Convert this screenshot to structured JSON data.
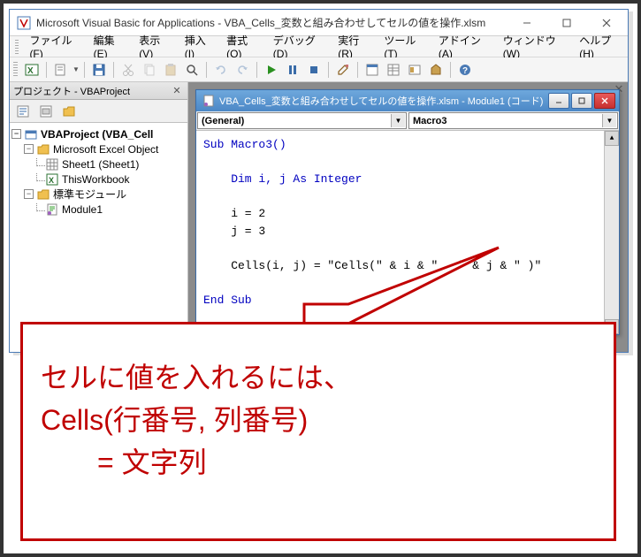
{
  "window": {
    "title": "Microsoft Visual Basic for Applications - VBA_Cells_変数と組み合わせしてセルの値を操作.xlsm"
  },
  "menu": {
    "file": "ファイル(F)",
    "edit": "編集(E)",
    "view": "表示(V)",
    "insert": "挿入(I)",
    "format": "書式(O)",
    "debug": "デバッグ(D)",
    "run": "実行(R)",
    "tools": "ツール(T)",
    "addins": "アドイン(A)",
    "window": "ウィンドウ(W)",
    "help": "ヘルプ(H)"
  },
  "project_panel": {
    "title": "プロジェクト - VBAProject",
    "root": "VBAProject (VBA_Cell",
    "excel_objects": "Microsoft Excel Object",
    "sheet1": "Sheet1 (Sheet1)",
    "thisworkbook": "ThisWorkbook",
    "std_modules": "標準モジュール",
    "module1": "Module1"
  },
  "code_window": {
    "title": "VBA_Cells_変数と組み合わせしてセルの値を操作.xlsm - Module1 (コード)",
    "dropdown_left": "(General)",
    "dropdown_right": "Macro3",
    "code_sub": "Sub Macro3()",
    "code_dim": "    Dim i, j As Integer",
    "code_i": "    i = 2",
    "code_j": "    j = 3",
    "code_cells": "    Cells(i, j) = \"Cells(\" & i & \" , \" & j & \" )\"",
    "code_end": "End Sub"
  },
  "callout": {
    "line1": "セルに値を入れるには、",
    "line2": "Cells(行番号, 列番号)",
    "line3": "　　= 文字列"
  }
}
